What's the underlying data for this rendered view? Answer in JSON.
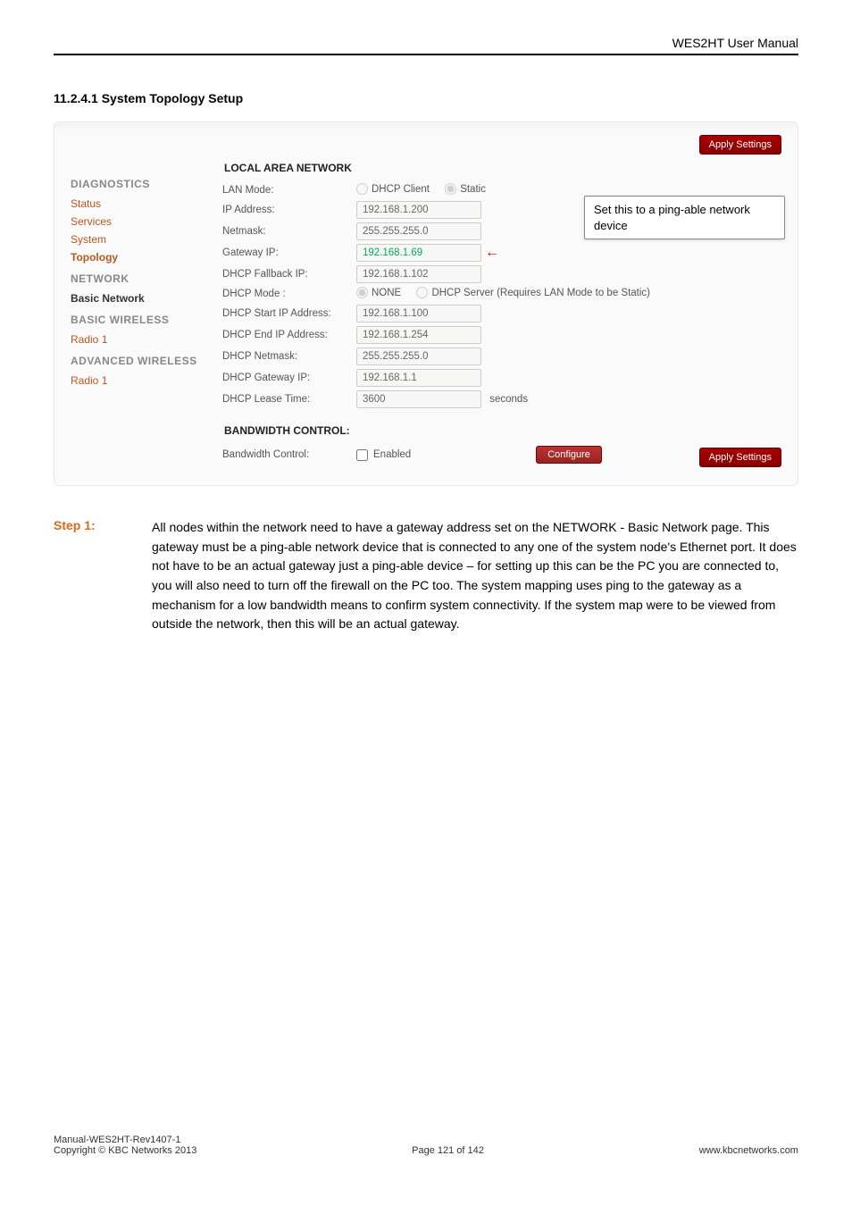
{
  "doc": {
    "header_right": "WES2HT User Manual",
    "section_heading": "11.2.4.1 System Topology Setup"
  },
  "panel": {
    "apply_label": "Apply Settings",
    "sidebar": {
      "group1": "DIAGNOSTICS",
      "status": "Status",
      "services": "Services",
      "system": "System",
      "topology": "Topology",
      "group2": "NETWORK",
      "basic_network": "Basic Network",
      "group3": "BASIC WIRELESS",
      "radio1a": "Radio 1",
      "group4": "ADVANCED WIRELESS",
      "radio1b": "Radio 1"
    },
    "lan": {
      "title": "LOCAL AREA NETWORK",
      "mode_label": "LAN Mode:",
      "mode_dhcp": "DHCP Client",
      "mode_static": "Static",
      "ip_label": "IP Address:",
      "ip_value": "192.168.1.200",
      "netmask_label": "Netmask:",
      "netmask_value": "255.255.255.0",
      "gateway_label": "Gateway IP:",
      "gateway_value": "192.168.1.69",
      "fallback_label": "DHCP Fallback IP:",
      "fallback_value": "192.168.1.102",
      "dhcp_mode_label": "DHCP Mode :",
      "dhcp_none": "NONE",
      "dhcp_server": "DHCP Server (Requires LAN Mode to be Static)",
      "dhcp_start_label": "DHCP Start IP Address:",
      "dhcp_start_value": "192.168.1.100",
      "dhcp_end_label": "DHCP End IP Address:",
      "dhcp_end_value": "192.168.1.254",
      "dhcp_netmask_label": "DHCP Netmask:",
      "dhcp_netmask_value": "255.255.255.0",
      "dhcp_gw_label": "DHCP Gateway IP:",
      "dhcp_gw_value": "192.168.1.1",
      "lease_label": "DHCP Lease Time:",
      "lease_value": "3600",
      "lease_unit": "seconds"
    },
    "bw": {
      "title": "BANDWIDTH CONTROL:",
      "label": "Bandwidth Control:",
      "enabled": "Enabled",
      "configure": "Configure"
    },
    "callout": "Set this to a ping-able network device"
  },
  "step": {
    "label": "Step 1:",
    "text": "All nodes within the network need to have a gateway address set on the NETWORK - Basic Network page. This gateway must be a ping-able network device that is connected to any one of the system node's Ethernet port. It does not have to be an actual gateway just a ping-able device – for setting up this can be the PC you are connected to, you will also need to turn off the firewall on the PC too. The system mapping uses ping to the gateway as a mechanism for a low bandwidth means to confirm system connectivity. If the system map were to be viewed from outside the network, then this will be an actual gateway."
  },
  "footer": {
    "left1": "Manual-WES2HT-Rev1407-1",
    "left2": "Copyright © KBC Networks 2013",
    "center": "Page 121 of 142",
    "right": "www.kbcnetworks.com"
  }
}
